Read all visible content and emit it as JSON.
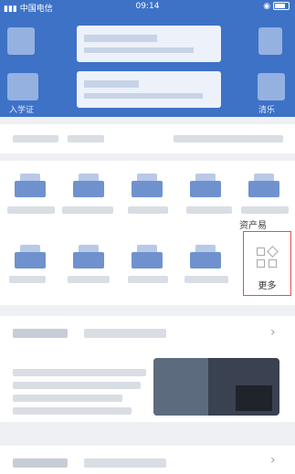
{
  "status_bar": {
    "carrier": "中国电信",
    "time": "09:14",
    "battery_icon": "battery-icon"
  },
  "header": {
    "left_bottom_label": "入学证",
    "right_bottom_label": "清乐"
  },
  "grid": {
    "row1_partial_label": "资产易"
  },
  "more": {
    "label": "更多",
    "icon": "grid-apps-icon",
    "highlight_color": "#e35050"
  },
  "colors": {
    "brand": "#3d72c6",
    "page_bg": "#eef0f4"
  }
}
